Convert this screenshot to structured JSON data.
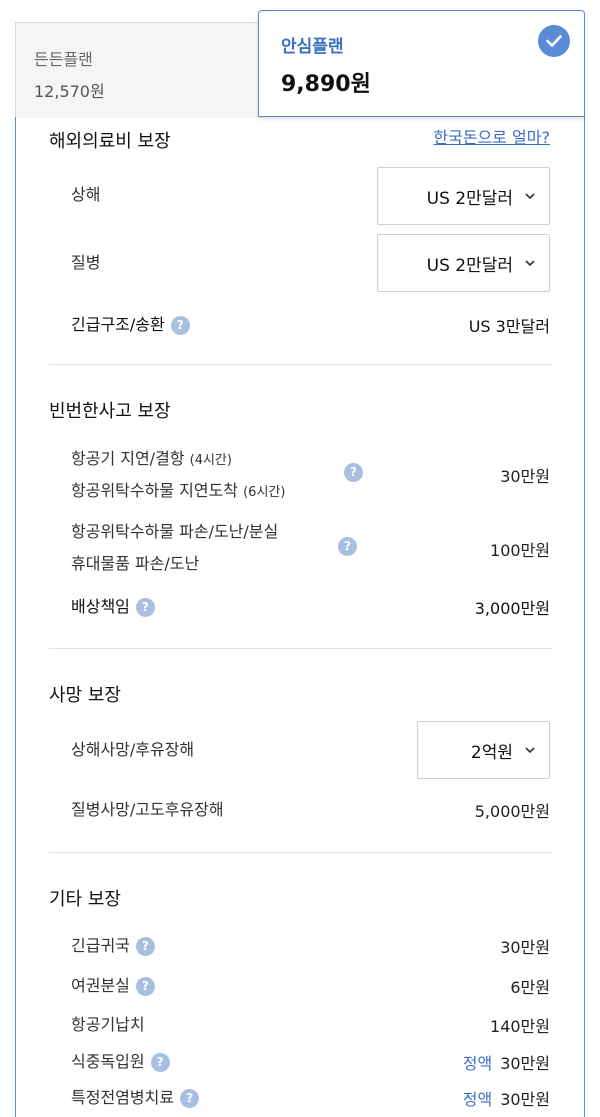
{
  "plans": {
    "basic": {
      "name": "든든플랜",
      "price": "12,570원"
    },
    "selected": {
      "name": "안심플랜",
      "price": "9,890원",
      "check_icon": "check-circle-icon"
    }
  },
  "colors": {
    "accent": "#3a6fc4",
    "selected_border": "#5b8ad6",
    "help_icon": "#a9bfe0"
  },
  "overseas": {
    "title": "해외의료비 보장",
    "link": "한국돈으로 얼마?",
    "injury": {
      "label": "상해",
      "value": "US 2만달러"
    },
    "illness": {
      "label": "질병",
      "value": "US 2만달러"
    },
    "rescue": {
      "label": "긴급구조/송환",
      "value": "US 3만달러"
    }
  },
  "frequent": {
    "title": "빈번한사고 보장",
    "delay": {
      "line1": "항공기 지연/결항",
      "line1_note": "(4시간)",
      "line2": "항공위탁수하물 지연도착",
      "line2_note": "(6시간)",
      "value": "30만원"
    },
    "damage": {
      "line1": "항공위탁수하물 파손/도난/분실",
      "line2": "휴대물품 파손/도난",
      "value": "100만원"
    },
    "liability": {
      "label": "배상책임",
      "value": "3,000만원"
    }
  },
  "death": {
    "title": "사망 보장",
    "injury_death": {
      "label": "상해사망/후유장해",
      "value": "2억원"
    },
    "illness_death": {
      "label": "질병사망/고도후유장해",
      "value": "5,000만원"
    }
  },
  "other": {
    "title": "기타 보장",
    "items": [
      {
        "label": "긴급귀국",
        "value": "30만원",
        "tag": "",
        "help": true
      },
      {
        "label": "여권분실",
        "value": "6만원",
        "tag": "",
        "help": true
      },
      {
        "label": "항공기납치",
        "value": "140만원",
        "tag": "",
        "help": false
      },
      {
        "label": "식중독입원",
        "value": "30만원",
        "tag": "정액",
        "help": true
      },
      {
        "label": "특정전염병치료",
        "value": "30만원",
        "tag": "정액",
        "help": true
      }
    ]
  },
  "help_icon_text": "?"
}
